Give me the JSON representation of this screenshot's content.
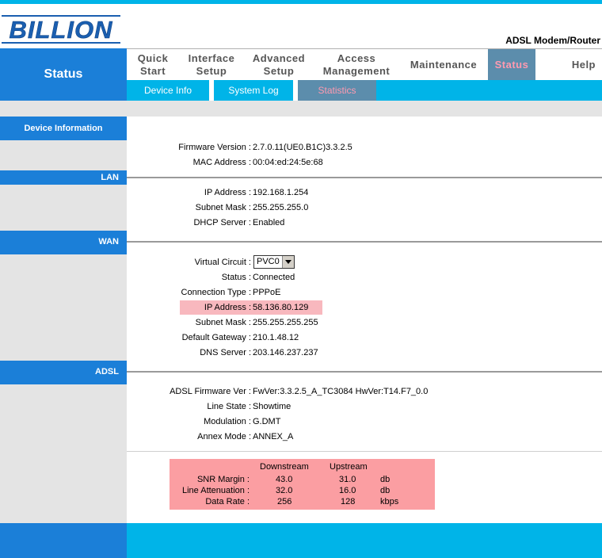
{
  "brand": {
    "logo_text": "BILLION",
    "product": "ADSL Modem/Router"
  },
  "sidebar": {
    "title": "Status"
  },
  "nav": {
    "items": [
      {
        "line1": "Quick",
        "line2": "Start"
      },
      {
        "line1": "Interface",
        "line2": "Setup"
      },
      {
        "line1": "Advanced",
        "line2": "Setup"
      },
      {
        "line1": "Access",
        "line2": "Management"
      },
      {
        "line1": "Maintenance"
      },
      {
        "line1": "Status"
      },
      {
        "line1": "Help"
      }
    ],
    "active": "Status"
  },
  "subnav": {
    "items": [
      "Device Info",
      "System Log",
      "Statistics"
    ],
    "active": "Statistics"
  },
  "sections": {
    "device": {
      "title": "Device Information",
      "rows": [
        {
          "label": "Firmware Version :",
          "value": "2.7.0.11(UE0.B1C)3.3.2.5"
        },
        {
          "label": "MAC Address :",
          "value": "00:04:ed:24:5e:68"
        }
      ]
    },
    "lan": {
      "title": "LAN",
      "rows": [
        {
          "label": "IP Address :",
          "value": "192.168.1.254"
        },
        {
          "label": "Subnet Mask :",
          "value": "255.255.255.0"
        },
        {
          "label": "DHCP Server :",
          "value": "Enabled"
        }
      ]
    },
    "wan": {
      "title": "WAN",
      "virtual_circuit_label": "Virtual Circuit :",
      "virtual_circuit_value": "PVC0",
      "rows": [
        {
          "label": "Status :",
          "value": "Connected"
        },
        {
          "label": "Connection Type :",
          "value": "PPPoE"
        },
        {
          "label": "IP Address :",
          "value": "58.136.80.129"
        },
        {
          "label": "Subnet Mask :",
          "value": "255.255.255.255"
        },
        {
          "label": "Default Gateway :",
          "value": "210.1.48.12"
        },
        {
          "label": "DNS Server :",
          "value": "203.146.237.237"
        }
      ]
    },
    "adsl": {
      "title": "ADSL",
      "rows": [
        {
          "label": "ADSL Firmware Ver :",
          "value": "FwVer:3.3.2.5_A_TC3084 HwVer:T14.F7_0.0"
        },
        {
          "label": "Line State :",
          "value": "Showtime"
        },
        {
          "label": "Modulation :",
          "value": "G.DMT"
        },
        {
          "label": "Annex Mode :",
          "value": "ANNEX_A"
        }
      ]
    }
  },
  "stats": {
    "headers": [
      "Downstream",
      "Upstream"
    ],
    "rows": [
      {
        "label": "SNR Margin :",
        "down": "43.0",
        "up": "31.0",
        "unit": "db"
      },
      {
        "label": "Line Attenuation :",
        "down": "32.0",
        "up": "16.0",
        "unit": "db"
      },
      {
        "label": "Data Rate :",
        "down": "256",
        "up": "128",
        "unit": "kbps"
      }
    ]
  },
  "colors": {
    "accent_blue": "#1b7fd8",
    "cyan": "#00b4e8",
    "active_tab": "#5c8dac",
    "active_text": "#ff9ab0",
    "highlight": "#f8b8be",
    "stats_bg": "#fb9ea2"
  }
}
